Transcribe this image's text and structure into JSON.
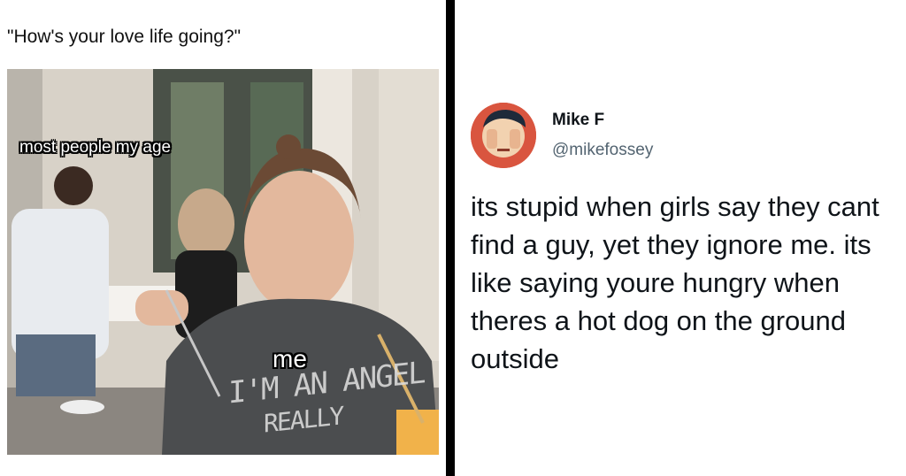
{
  "meme": {
    "caption": "\"How's your love life going?\"",
    "label_people": "most people my age",
    "label_me": "me",
    "shirt_line1": "I'M AN ANGEL",
    "shirt_line2": "REALLY"
  },
  "tweet": {
    "name": "Mike F",
    "handle": "@mikefossey",
    "text": "its stupid when girls say they cant find a guy, yet they ignore me. its like saying youre hungry when theres a hot dog on the ground outside"
  },
  "colors": {
    "background": "#000000",
    "panel": "#ffffff",
    "text": "#0f1419",
    "handle": "#536471"
  }
}
